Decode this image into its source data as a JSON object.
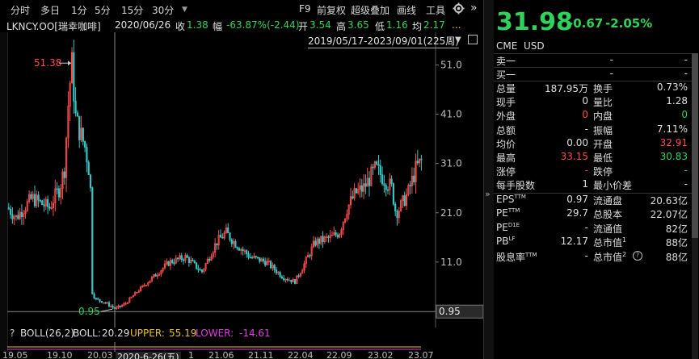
{
  "toolbar": {
    "items": [
      "分时",
      "多日",
      "1分",
      "5分",
      "15分",
      "30分",
      "F9",
      "前复权",
      "超级叠加",
      "画线",
      "工具"
    ],
    "more_arrow": "»"
  },
  "info": {
    "symbol": "LKNCY.OO[瑞幸咖啡]",
    "date": "2020/06/26",
    "close_label": "收",
    "close_value": "1.38",
    "amp_label": "幅",
    "amp_value": "-63.87%(-2.44)",
    "open_label": "开",
    "open_value": "3.54",
    "high_label": "高",
    "high_value": "3.65",
    "low_label": "低",
    "low_value": "1.16",
    "avg_label": "均",
    "avg_value": "2.17",
    "more": "..."
  },
  "range": {
    "label": "2019/05/17-2023/09/01(225周)"
  },
  "chart_data": {
    "type": "candlestick",
    "yaxis_ticks": [
      "51.0",
      "41.0",
      "31.0",
      "21.0",
      "11.0"
    ],
    "ylim": [
      0,
      56
    ],
    "max_label": "51.38",
    "min_label": "0.95",
    "current_price_label": "0.95",
    "x_ticks": [
      "19.05",
      "19.10",
      "20.03",
      "2020-6-26(五)",
      "1",
      "21.06",
      "21.11",
      "22.04",
      "22.09",
      "23.02",
      "23.07"
    ]
  },
  "indicator": {
    "question": "?",
    "name": "BOLL(26,2)",
    "boll_label": "BOLL:",
    "boll_value": "20.29",
    "upper_label": "UPPER:",
    "upper_value": "55.19",
    "lower_label": "LOWER:",
    "lower_value": "-14.61"
  },
  "quote": {
    "price": "31.98",
    "change": "-0.67",
    "change_pct": "-2.05%",
    "exchange": "CME",
    "currency": "USD",
    "sell1_label": "卖一",
    "sell1_price": "-",
    "sell1_vol": "-",
    "buy1_label": "买一",
    "buy1_price": "-",
    "buy1_vol": "-",
    "rows": [
      {
        "l1": "总量",
        "v1": "187.95万",
        "l2": "换手",
        "v2": "0.73%"
      },
      {
        "l1": "现手",
        "v1": "0",
        "l2": "量比",
        "v2": "1.28"
      },
      {
        "l1": "外盘",
        "v1": "0",
        "l2": "内盘",
        "v2": "0"
      },
      {
        "l1": "总额",
        "v1": "-",
        "l2": "振幅",
        "v2": "7.11%"
      },
      {
        "l1": "均价",
        "v1": "0.00",
        "l2": "开盘",
        "v2": "32.91"
      },
      {
        "l1": "最高",
        "v1": "33.15",
        "l2": "最低",
        "v2": "30.83"
      },
      {
        "l1": "涨停",
        "v1": "-",
        "l2": "跌停",
        "v2": "-"
      },
      {
        "l1": "每手股数",
        "v1": "1",
        "l2": "最小价差",
        "v2": "-"
      }
    ],
    "fin_rows": [
      {
        "l1": "EPS",
        "s1": "TTM",
        "v1": "0.97",
        "l2": "流通盘",
        "v2": "20.63亿"
      },
      {
        "l1": "PE",
        "s1": "TTM",
        "v1": "29.7",
        "l2": "总股本",
        "v2": "22.07亿"
      },
      {
        "l1": "PE",
        "s1": "D1E",
        "v1": "-",
        "l2": "流通值",
        "v2": "82亿"
      },
      {
        "l1": "PB",
        "s1": "LF",
        "v1": "12.17",
        "l2": "总市值",
        "s2": "1",
        "v2": "88亿"
      },
      {
        "l1": "股息率",
        "s1": "TTM",
        "v1": "-",
        "l2": "总市值",
        "s2": "2",
        "v2": "88亿"
      }
    ]
  },
  "colors": {
    "up": "#ff4a4a",
    "down": "#35c5c5",
    "green": "#2fd35a",
    "yellow": "#e6c229",
    "magenta": "#e03ce0",
    "bg": "#000000"
  },
  "icons": [
    "gear-icon",
    "double-chevron-right-icon",
    "chevron-down-icon",
    "square-icon",
    "help-icon"
  ]
}
